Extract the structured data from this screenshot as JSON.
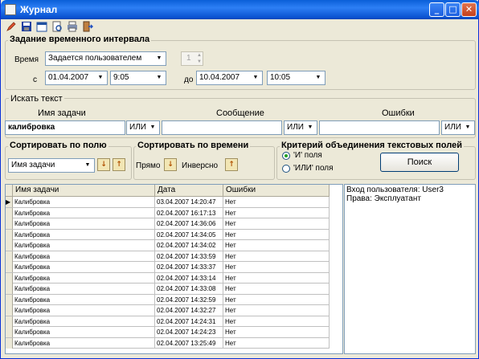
{
  "window": {
    "title": "Журнал"
  },
  "toolbar_icons": [
    "pencil-icon",
    "save-icon",
    "calendar-icon",
    "preview-icon",
    "print-icon",
    "exit-icon"
  ],
  "interval": {
    "group_label": "Задание временного интервала",
    "time_label": "Время",
    "time_mode": "Задается пользователем",
    "spin_value": "1",
    "from_label": "с",
    "from_date": "01.04.2007",
    "from_time": "9:05",
    "to_label": "до",
    "to_date": "10.04.2007",
    "to_time": "10:05"
  },
  "search": {
    "group_label": "Искать текст",
    "task_label": "Имя задачи",
    "task_value": "калибровка",
    "task_op": "ИЛИ",
    "message_label": "Сообщение",
    "message_value": "",
    "message_op": "ИЛИ",
    "errors_label": "Ошибки",
    "errors_value": "",
    "errors_op": "ИЛИ"
  },
  "sort_field": {
    "group_label": "Сортировать по полю",
    "value": "Имя задачи"
  },
  "sort_time": {
    "group_label": "Сортировать по времени",
    "direct_label": "Прямо",
    "inverse_label": "Инверсно"
  },
  "criteria": {
    "group_label": "Критерий объединения текстовых полей",
    "and_label": "'И' поля",
    "or_label": "'ИЛИ' поля",
    "selected": "and",
    "search_button": "Поиск"
  },
  "table": {
    "columns": [
      "Имя задачи",
      "Дата",
      "Ошибки"
    ],
    "current_row_marker": "▶",
    "rows": [
      [
        "Калибровка",
        "03.04.2007 14:20:47",
        "Нет"
      ],
      [
        "Калибровка",
        "02.04.2007 16:17:13",
        "Нет"
      ],
      [
        "Калибровка",
        "02.04.2007 14:36:06",
        "Нет"
      ],
      [
        "Калибровка",
        "02.04.2007 14:34:05",
        "Нет"
      ],
      [
        "Калибровка",
        "02.04.2007 14:34:02",
        "Нет"
      ],
      [
        "Калибровка",
        "02.04.2007 14:33:59",
        "Нет"
      ],
      [
        "Калибровка",
        "02.04.2007 14:33:37",
        "Нет"
      ],
      [
        "Калибровка",
        "02.04.2007 14:33:14",
        "Нет"
      ],
      [
        "Калибровка",
        "02.04.2007 14:33:08",
        "Нет"
      ],
      [
        "Калибровка",
        "02.04.2007 14:32:59",
        "Нет"
      ],
      [
        "Калибровка",
        "02.04.2007 14:32:27",
        "Нет"
      ],
      [
        "Калибровка",
        "02.04.2007 14:24:31",
        "Нет"
      ],
      [
        "Калибровка",
        "02.04.2007 14:24:23",
        "Нет"
      ],
      [
        "Калибровка",
        "02.04.2007 13:25:49",
        "Нет"
      ]
    ]
  },
  "info": {
    "user_line": "Вход пользователя: User3",
    "rights_line": "Права: Эксплуатант"
  }
}
